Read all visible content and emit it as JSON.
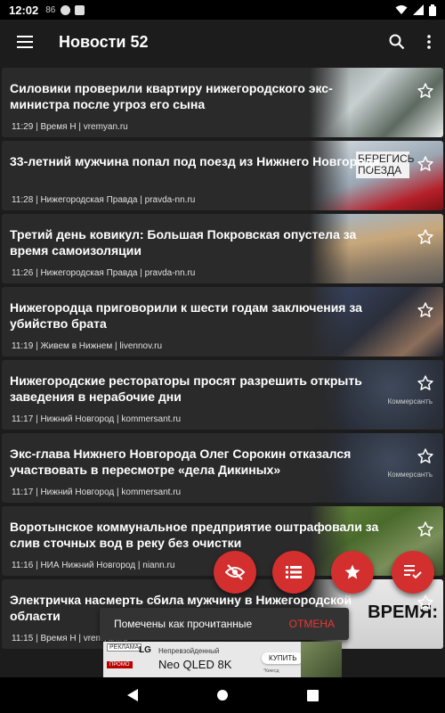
{
  "status_bar": {
    "time": "12:02",
    "signal_text": "86"
  },
  "app_bar": {
    "title": "Новости 52"
  },
  "articles": [
    {
      "headline": "Силовики проверили квартиру нижегородского экс-министра после угроз его сына",
      "time": "11:29",
      "source": "Время Н | vremyan.ru",
      "thumb": "window"
    },
    {
      "headline": "33-летний мужчина попал под поезд из Нижнего Новгорода",
      "time": "11:28",
      "source": "Нижегородская Правда | pravda-nn.ru",
      "thumb": "train-sign",
      "thumb_text": "БЕРЕГИСЬ ПОЕЗДА"
    },
    {
      "headline": "Третий день ковикул: Большая Покровская опустела за время самоизоляции",
      "time": "11:26",
      "source": "Нижегородская Правда | pravda-nn.ru",
      "thumb": "street"
    },
    {
      "headline": "Нижегородца приговорили к шести годам заключения за убийство брата",
      "time": "11:19",
      "source": "Живем в Нижнем | livennov.ru",
      "thumb": "court"
    },
    {
      "headline": "Нижегородские рестораторы просят разрешить открыть заведения в нерабочие дни",
      "time": "11:17",
      "source": "Нижний Новгород | kommersant.ru",
      "thumb": "kommersant",
      "thumb_text": "Коммерсантъ"
    },
    {
      "headline": "Экс-глава Нижнего Новгорода Олег Сорокин отказался участвовать в пересмотре «дела Дикиных»",
      "time": "11:17",
      "source": "Нижний Новгород | kommersant.ru",
      "thumb": "kommersant",
      "thumb_text": "Коммерсантъ"
    },
    {
      "headline": "Воротынское коммунальное предприятие оштрафовали за слив сточных вод в реку без очистки",
      "time": "11:16",
      "source": "НИА Нижний Новгород | niann.ru",
      "thumb": "field"
    },
    {
      "headline": "Электричка насмерть сбила мужчину в Нижегородской области",
      "time": "11:15",
      "source": "Время Н | vremyan.ru",
      "thumb": "vremya",
      "thumb_text": "ВРЕМЯ:"
    }
  ],
  "snackbar": {
    "message": "Помечены как прочитанные",
    "action": "ОТМЕНА"
  },
  "ad": {
    "tag": "РЕКЛАМА",
    "promo": "ПРОМО",
    "brand_fragment": "LG",
    "tagline": "Непревзойденный",
    "product": "Neo QLED 8K",
    "button": "КУПИТЬ",
    "note": "*Кингсд"
  },
  "colors": {
    "fab": "#d32f2f",
    "snackbar_action": "#e53935"
  }
}
